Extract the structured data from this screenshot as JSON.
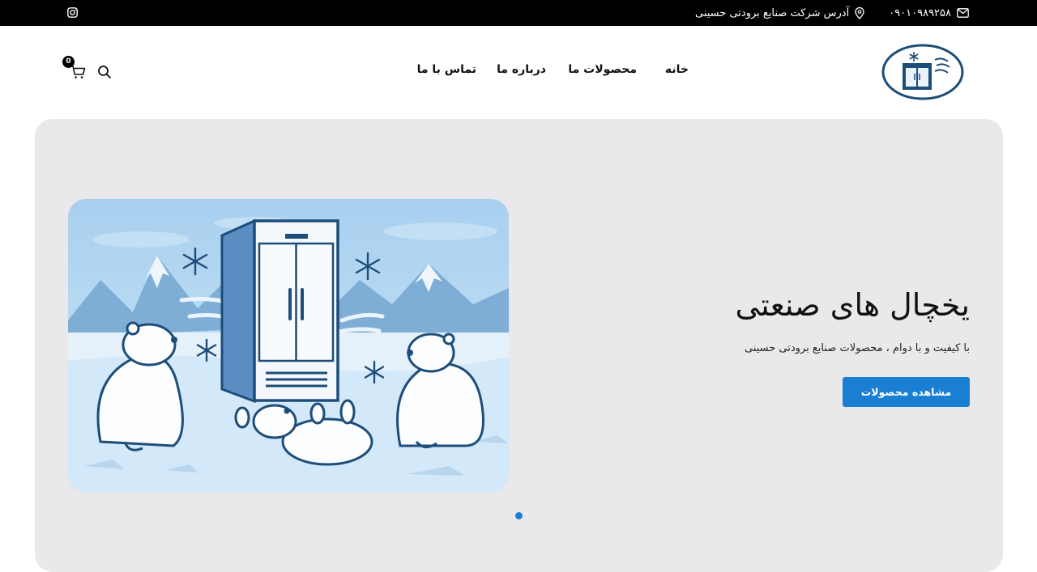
{
  "topbar": {
    "phone": "۰۹۰۱۰۹۸۹۲۵۸",
    "address": "آدرس شرکت صنایع برودتی حسینی",
    "icons": [
      "mail-icon",
      "location-pin-icon",
      "instagram-icon"
    ]
  },
  "nav": {
    "items": [
      "خانه",
      "محصولات ما",
      "درباره ما",
      "تماس با ما"
    ]
  },
  "cart": {
    "count": "0"
  },
  "hero": {
    "title": "یخچال های صنعتی",
    "subtitle": "با کیفیت و با دوام ، محصولات صنایع برودتی حسینی",
    "button_label": "مشاهده محصولات"
  },
  "colors": {
    "topbar_bg": "#000000",
    "accent": "#1a7fd3",
    "hero_bg": "#e9e9eb",
    "logo_navy": "#1d4d78"
  }
}
